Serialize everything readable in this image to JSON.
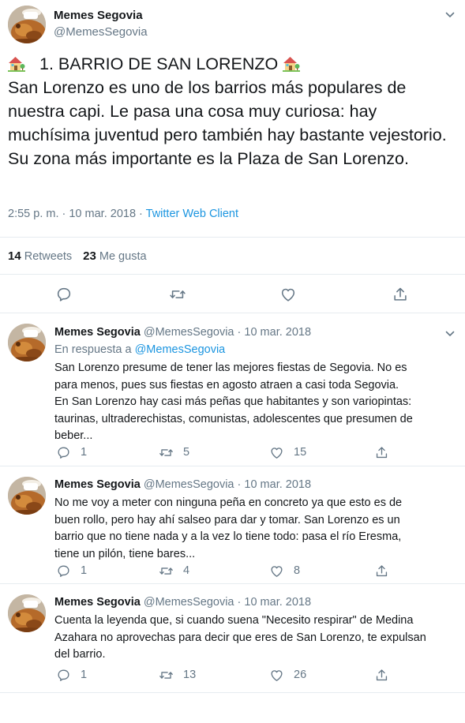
{
  "main_tweet": {
    "display_name": "Memes Segovia",
    "handle": "@MemesSegovia",
    "title": "1. BARRIO DE SAN LORENZO",
    "title_emoji": "house-with-garden-icon",
    "body": "San Lorenzo es uno de los barrios más populares de nuestra capi. Le pasa una cosa muy curiosa: hay muchísima juventud pero también hay bastante vejestorio. Su zona más importante es la Plaza de San Lorenzo.",
    "timestamp": "2:55 p. m. · 10 mar. 2018 · ",
    "client": "Twitter Web Client",
    "retweets_count": "14",
    "retweets_label": "Retweets",
    "likes_count": "23",
    "likes_label": "Me gusta"
  },
  "replies": [
    {
      "display_name": "Memes Segovia",
      "handle": "@MemesSegovia",
      "separator": " · ",
      "date": "10 mar. 2018",
      "in_reply_prefix": "En respuesta a ",
      "in_reply_handle": "@MemesSegovia",
      "lines": [
        "San Lorenzo presume de tener las mejores fiestas de Segovia. No es",
        "para menos, pues sus fiestas en agosto atraen a casi toda Segovia.",
        "En San Lorenzo hay casi más peñas que habitantes y son variopintas:",
        "taurinas, ultraderechistas, comunistas, adolescentes que presumen de",
        "beber..."
      ],
      "replies_count": "1",
      "retweets_count": "5",
      "likes_count": "15"
    },
    {
      "display_name": "Memes Segovia",
      "handle": "@MemesSegovia",
      "separator": " · ",
      "date": "10 mar. 2018",
      "lines": [
        "No me voy a meter con ninguna peña en concreto ya que esto es de",
        "buen rollo, pero hay ahí salseo para dar y tomar. San Lorenzo es un",
        "barrio que no tiene nada y a la vez lo tiene todo: pasa el río Eresma,",
        "tiene un pilón, tiene bares..."
      ],
      "replies_count": "1",
      "retweets_count": "4",
      "likes_count": "8"
    },
    {
      "display_name": "Memes Segovia",
      "handle": "@MemesSegovia",
      "separator": " · ",
      "date": "10 mar. 2018",
      "lines": [
        "Cuenta la leyenda que, si cuando suena \"Necesito respirar\" de Medina",
        "Azahara no aprovechas para decir que eres de San Lorenzo, te expulsan",
        "del barrio."
      ],
      "replies_count": "1",
      "retweets_count": "13",
      "likes_count": "26"
    }
  ],
  "colors": {
    "text": "#14171a",
    "secondary": "#657786",
    "link": "#1b95e0",
    "divider": "#e6ecf0"
  }
}
